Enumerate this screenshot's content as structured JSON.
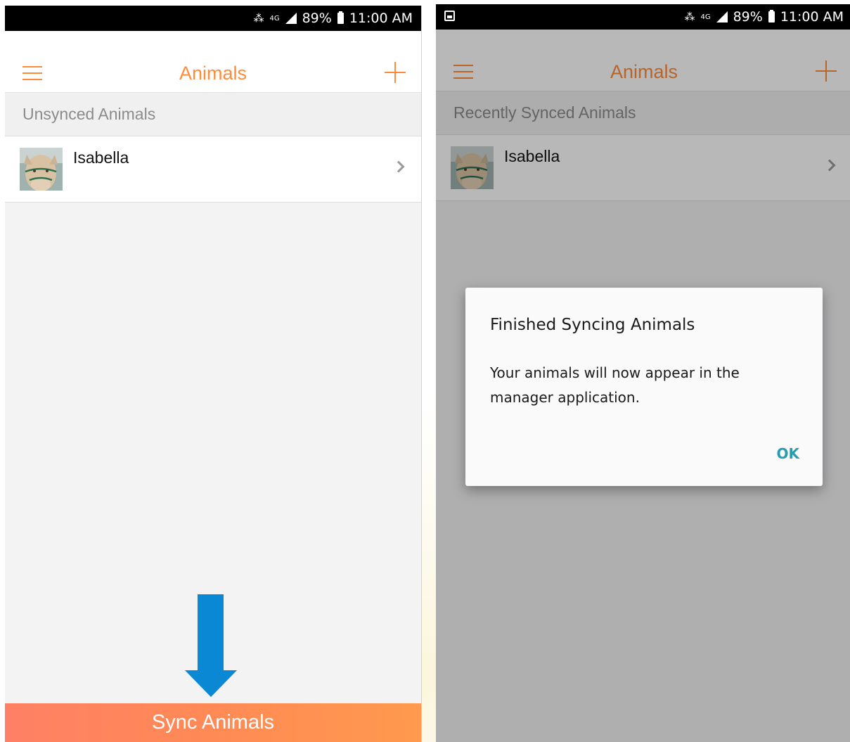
{
  "status_bar": {
    "time": "11:00 AM",
    "battery": "89%",
    "network": "4G"
  },
  "left_screen": {
    "title": "Animals",
    "section_header": "Unsynced Animals",
    "animals": [
      {
        "name": "Isabella"
      }
    ],
    "sync_button_label": "Sync Animals"
  },
  "right_screen": {
    "title": "Animals",
    "section_header": "Recently Synced Animals",
    "animals": [
      {
        "name": "Isabella"
      }
    ],
    "dialog": {
      "title": "Finished Syncing Animals",
      "message": "Your animals will now appear in the manager application.",
      "ok_label": "OK"
    }
  },
  "colors": {
    "accent": "#ff8c3a",
    "arrow": "#0b88d4",
    "dialog_button": "#2a9cb0"
  },
  "icons": [
    "hamburger-menu-icon",
    "plus-icon",
    "chevron-right-icon",
    "mute-icon",
    "signal-icon",
    "battery-icon",
    "gallery-notification-icon",
    "down-arrow-icon"
  ]
}
